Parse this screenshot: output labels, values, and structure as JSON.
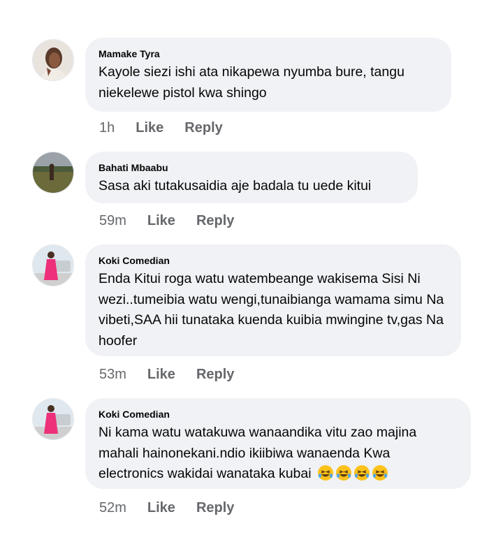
{
  "comments": [
    {
      "author": "Mamake Tyra",
      "text": "Kayole siezi ishi ata nikapewa nyumba bure, tangu niekelewe pistol kwa shingo",
      "time": "1h",
      "like_label": "Like",
      "reply_label": "Reply"
    },
    {
      "author": "Bahati Mbaabu",
      "text": "Sasa aki tutakusaidia aje badala tu uede kitui",
      "time": "59m",
      "like_label": "Like",
      "reply_label": "Reply"
    },
    {
      "author": "Koki Comedian",
      "text": "Enda Kitui roga watu watembeange wakisema Sisi Ni wezi..tumeibia watu wengi,tunaibianga wamama simu Na vibeti,SAA hii tunataka kuenda kuibia mwingine tv,gas Na hoofer",
      "time": "53m",
      "like_label": "Like",
      "reply_label": "Reply"
    },
    {
      "author": "Koki Comedian",
      "text": "Ni kama watu watakuwa wanaandika vitu zao majina mahali hainonekani.ndio ikiibiwa wanaenda Kwa electronics wakidai wanataka kubai",
      "emoji_count": 4,
      "emoji_name": "rolling-on-the-floor-laughing-emoji",
      "time": "52m",
      "like_label": "Like",
      "reply_label": "Reply"
    }
  ]
}
